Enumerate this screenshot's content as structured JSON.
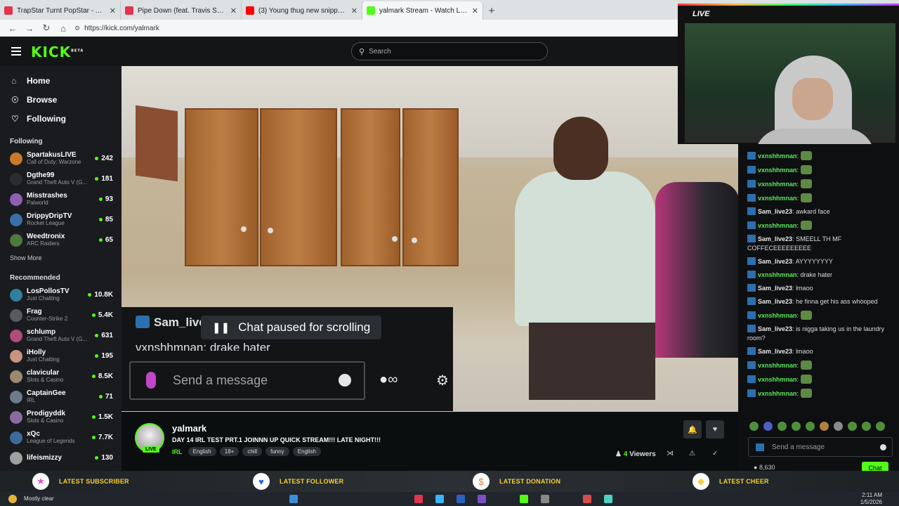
{
  "browser": {
    "tabs": [
      {
        "title": "TrapStar Turnt PopStar - Album",
        "color": "#e2334f"
      },
      {
        "title": "Pipe Down (feat. Travis Scott) - So",
        "color": "#e2334f"
      },
      {
        "title": "(3) Young thug new snippet crazy",
        "color": "#ff0000"
      },
      {
        "title": "yalmark Stream - Watch Live on K",
        "color": "#53fc18"
      }
    ],
    "url": "https://kick.com/yalmark"
  },
  "header": {
    "logo": "KICK",
    "logo_badge": "BETA",
    "search_placeholder": "Search"
  },
  "sidebar": {
    "nav": [
      {
        "label": "Home",
        "icon": "home-icon"
      },
      {
        "label": "Browse",
        "icon": "compass-icon"
      },
      {
        "label": "Following",
        "icon": "heart-icon"
      }
    ],
    "following_title": "Following",
    "following": [
      {
        "name": "SpartakusLIVE",
        "game": "Call of Duty: Warzone",
        "viewers": "242",
        "color": "#c87a2a"
      },
      {
        "name": "Dgthe99",
        "game": "Grand Theft Auto V (G...",
        "viewers": "181",
        "color": "#2d2d2d"
      },
      {
        "name": "Misstrashes",
        "game": "Palworld",
        "viewers": "93",
        "color": "#8f5fb0"
      },
      {
        "name": "DrippyDripTV",
        "game": "Rocket League",
        "viewers": "85",
        "color": "#3a6fa8"
      },
      {
        "name": "Weedtronix",
        "game": "ARC Raiders",
        "viewers": "65",
        "color": "#4c7a3a"
      }
    ],
    "show_more": "Show More",
    "recommended_title": "Recommended",
    "recommended": [
      {
        "name": "LosPollosTV",
        "game": "Just Chatting",
        "viewers": "10.8K",
        "color": "#2f7f9f"
      },
      {
        "name": "Frag",
        "game": "Counter-Strike 2",
        "viewers": "5.4K",
        "color": "#555b61"
      },
      {
        "name": "schlump",
        "game": "Grand Theft Auto V (G...",
        "viewers": "631",
        "color": "#b04b7a"
      },
      {
        "name": "iHolly",
        "game": "Just Chatting",
        "viewers": "195",
        "color": "#c99480"
      },
      {
        "name": "clavicular",
        "game": "Slots & Casino",
        "viewers": "8.5K",
        "color": "#9a8a6e"
      },
      {
        "name": "CaptainGee",
        "game": "IRL",
        "viewers": "71",
        "color": "#6c7c8c"
      },
      {
        "name": "Prodigyddk",
        "game": "Slots & Casino",
        "viewers": "1.5K",
        "color": "#8a6aa0"
      },
      {
        "name": "xQc",
        "game": "League of Legends",
        "viewers": "7.7K",
        "color": "#3e6a9a"
      },
      {
        "name": "lifeismizzy",
        "game": "",
        "viewers": "130",
        "color": "#a0a0a0"
      }
    ]
  },
  "overlay": {
    "line1": "Sam_live",
    "line2": "vxnshhmnan: drake hater",
    "paused": "Chat paused for scrolling",
    "input_placeholder": "Send a message"
  },
  "channel": {
    "name": "yalmark",
    "live_badge": "LIVE",
    "title": "DAY 14 IRL TEST PRT.1 JOINNN UP QUICK STREAM!!! LATE NIGHT!!!",
    "category": "IRL",
    "tags": [
      "English",
      "18+",
      "chill",
      "funny",
      "English"
    ],
    "viewers_count": "4",
    "viewers_label": "Viewers"
  },
  "webcam": {
    "label": "LIVE"
  },
  "chat": {
    "messages": [
      {
        "user": "vxnshhmnan",
        "text": "",
        "emote": true,
        "vx": true
      },
      {
        "user": "vxnshhmnan",
        "text": "",
        "emote": true,
        "vx": true
      },
      {
        "user": "vxnshhmnan",
        "text": "",
        "emote": true,
        "vx": true
      },
      {
        "user": "vxnshhmnan",
        "text": "",
        "emote": true,
        "vx": true
      },
      {
        "user": "Sam_live23",
        "text": "awkard face",
        "emote": false,
        "vx": false
      },
      {
        "user": "vxnshhmnan",
        "text": "",
        "emote": true,
        "vx": true
      },
      {
        "user": "Sam_live23",
        "text": "SMEELL TH MF COFFECEEEEEEEEE",
        "emote": false,
        "vx": false
      },
      {
        "user": "Sam_live23",
        "text": "AYYYYYYYY",
        "emote": false,
        "vx": false
      },
      {
        "user": "vxnshhmnan",
        "text": "drake hater",
        "emote": false,
        "vx": true
      },
      {
        "user": "Sam_live23",
        "text": "lmaoo",
        "emote": false,
        "vx": false
      },
      {
        "user": "Sam_live23",
        "text": "he finna get his ass whooped",
        "emote": false,
        "vx": false
      },
      {
        "user": "vxnshhmnan",
        "text": "",
        "emote": true,
        "vx": true
      },
      {
        "user": "Sam_live23",
        "text": "is nigga taking us in the laundry room?",
        "emote": false,
        "vx": false
      },
      {
        "user": "Sam_live23",
        "text": "lmaoo",
        "emote": false,
        "vx": false
      },
      {
        "user": "vxnshhmnan",
        "text": "",
        "emote": true,
        "vx": true
      },
      {
        "user": "vxnshhmnan",
        "text": "",
        "emote": true,
        "vx": true
      },
      {
        "user": "vxnshhmnan",
        "text": "",
        "emote": true,
        "vx": true
      }
    ],
    "input_placeholder": "Send a message",
    "points": "8,630",
    "chat_button": "Chat"
  },
  "alerts": [
    {
      "label": "LATEST SUBSCRIBER",
      "icon": "star-icon",
      "color": "#e84fd0"
    },
    {
      "label": "LATEST FOLLOWER",
      "icon": "heart-icon",
      "color": "#2563d9"
    },
    {
      "label": "LATEST DONATION",
      "icon": "dollar-icon",
      "color": "#f07a2a"
    },
    {
      "label": "LATEST CHEER",
      "icon": "diamond-icon",
      "color": "#f6cf3a"
    }
  ],
  "taskbar": {
    "weather": "Mostly clear",
    "time": "2:11 AM",
    "date": "1/5/2026"
  }
}
